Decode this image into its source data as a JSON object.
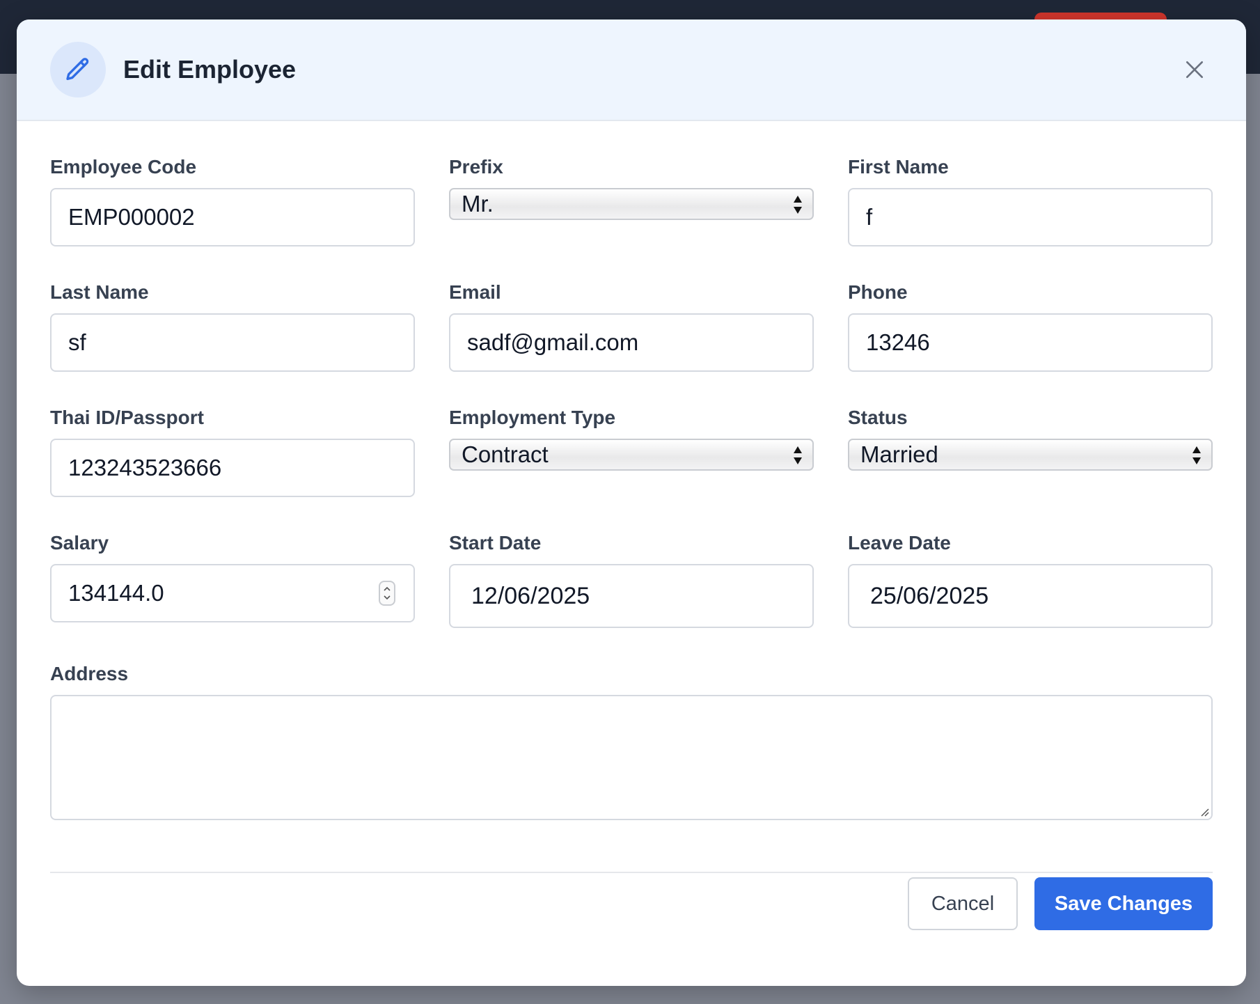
{
  "modal": {
    "title": "Edit Employee",
    "icon": "pencil-icon",
    "close_icon": "close-icon"
  },
  "fields": {
    "employee_code": {
      "label": "Employee Code",
      "value": "EMP000002"
    },
    "prefix": {
      "label": "Prefix",
      "value": "Mr."
    },
    "first_name": {
      "label": "First Name",
      "value": "f"
    },
    "last_name": {
      "label": "Last Name",
      "value": "sf"
    },
    "email": {
      "label": "Email",
      "value": "sadf@gmail.com"
    },
    "phone": {
      "label": "Phone",
      "value": "13246"
    },
    "thai_id": {
      "label": "Thai ID/Passport",
      "value": "123243523666"
    },
    "employment_type": {
      "label": "Employment Type",
      "value": "Contract"
    },
    "status": {
      "label": "Status",
      "value": "Married"
    },
    "salary": {
      "label": "Salary",
      "value": "134144.0"
    },
    "start_date": {
      "label": "Start Date",
      "value": "12/06/2025"
    },
    "leave_date": {
      "label": "Leave Date",
      "value": "25/06/2025"
    },
    "address": {
      "label": "Address",
      "value": ""
    }
  },
  "buttons": {
    "cancel": "Cancel",
    "save": "Save Changes"
  },
  "colors": {
    "accent": "#2f6ce5",
    "header_bg": "#eef5fe",
    "topbar": "#1f2737",
    "topbar_button": "#d0352c"
  }
}
